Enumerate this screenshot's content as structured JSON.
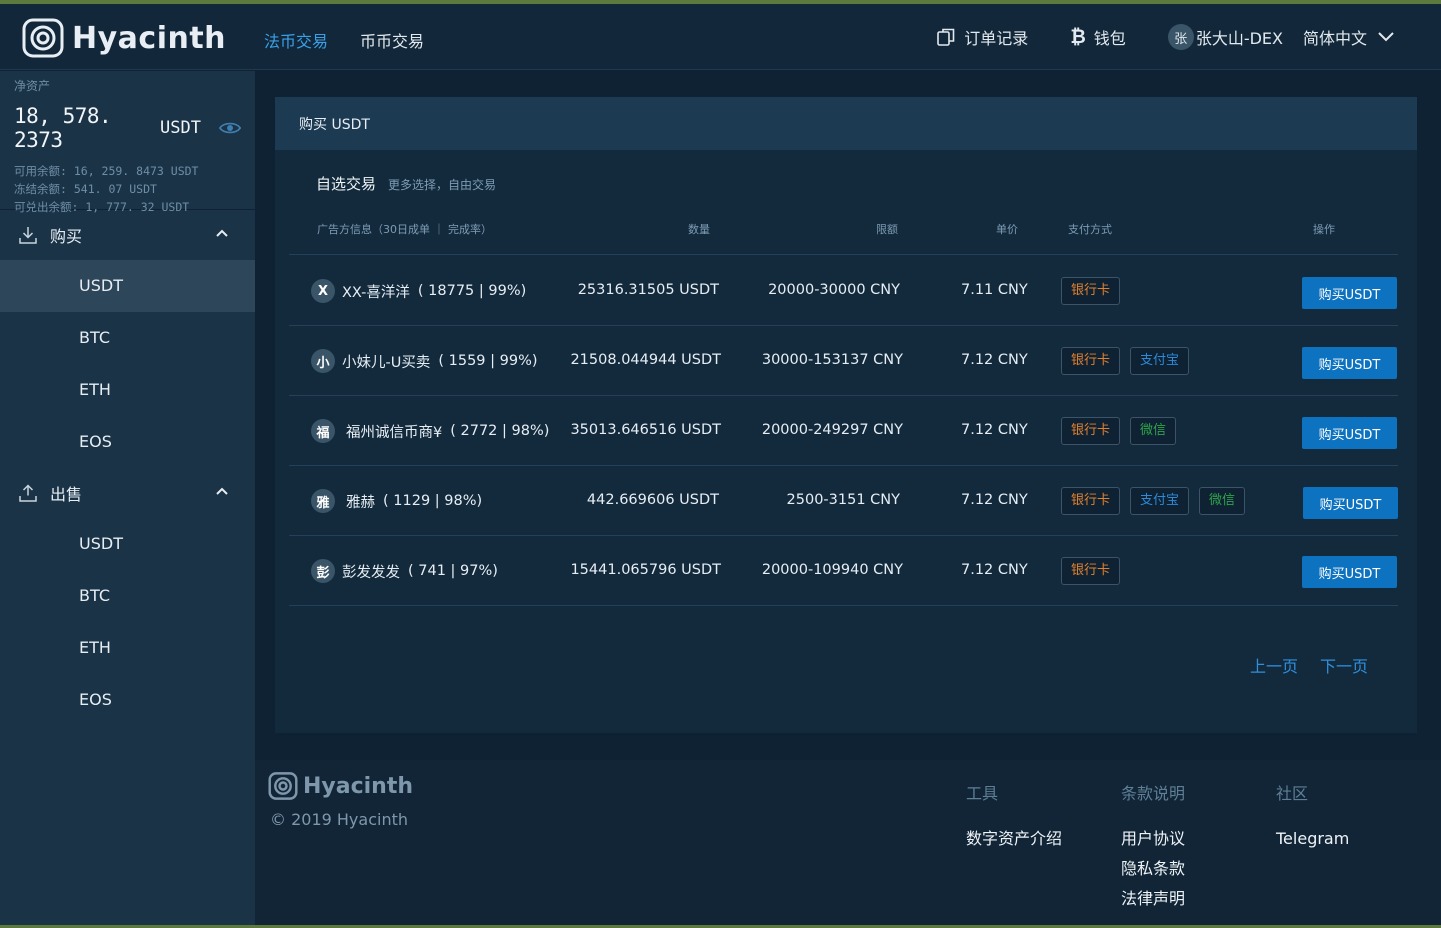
{
  "app": {
    "brand": "Hyacinth"
  },
  "nav": {
    "tabs": [
      {
        "label": "法币交易"
      },
      {
        "label": "币币交易"
      }
    ]
  },
  "header": {
    "orders_label": "订单记录",
    "wallet_label": "钱包",
    "user_avatar": "张",
    "username": "张大山-DEX",
    "language": "简体中文"
  },
  "assets": {
    "label": "净资产",
    "total": "18, 578. 2373",
    "unit": "USDT",
    "available": "可用余额: 16, 259. 8473 USDT",
    "frozen": "冻结余额: 541. 07 USDT",
    "withdrawable": "可兑出余额: 1, 777. 32 USDT"
  },
  "sidebar": {
    "buy_group": "购买",
    "sell_group": "出售",
    "buy_items": [
      "USDT",
      "BTC",
      "ETH",
      "EOS"
    ],
    "sell_items": [
      "USDT",
      "BTC",
      "ETH",
      "EOS"
    ]
  },
  "main": {
    "card_title": "购买 USDT",
    "section_title": "自选交易",
    "section_sub": "更多选择，自由交易",
    "columns": {
      "advertiser": "广告方信息（30日成单 ｜ 完成率）",
      "quantity": "数量",
      "limit": "限额",
      "price": "单价",
      "payment": "支付方式",
      "action": "操作"
    },
    "rows": [
      {
        "avatar": "X",
        "name": "XX-喜洋洋",
        "stats": "( 18775 | 99%)",
        "quantity": "25316.31505 USDT",
        "limit": "20000-30000 CNY",
        "price": "7.11 CNY",
        "payments": [
          "银行卡"
        ],
        "action": "购买USDT"
      },
      {
        "avatar": "小",
        "name": "小妹儿-U买卖",
        "stats": "( 1559 | 99%)",
        "quantity": "21508.044944 USDT",
        "limit": "30000-153137 CNY",
        "price": "7.12 CNY",
        "payments": [
          "银行卡",
          "支付宝"
        ],
        "action": "购买USDT"
      },
      {
        "avatar": "福",
        "name": "福州诚信币商¥",
        "stats": "( 2772 | 98%)",
        "quantity": "35013.646516 USDT",
        "limit": "20000-249297 CNY",
        "price": "7.12 CNY",
        "payments": [
          "银行卡",
          "微信"
        ],
        "action": "购买USDT"
      },
      {
        "avatar": "雅",
        "name": "雅赫",
        "stats": "( 1129 | 98%)",
        "quantity": "442.669606 USDT",
        "limit": "2500-3151 CNY",
        "price": "7.12 CNY",
        "payments": [
          "银行卡",
          "支付宝",
          "微信"
        ],
        "action": "购买USDT"
      },
      {
        "avatar": "彭",
        "name": "彭发发发",
        "stats": "( 741 | 97%)",
        "quantity": "15441.065796 USDT",
        "limit": "20000-109940 CNY",
        "price": "7.12 CNY",
        "payments": [
          "银行卡"
        ],
        "action": "购买USDT"
      }
    ],
    "pager": {
      "prev": "上一页",
      "next": "下一页"
    }
  },
  "footer": {
    "brand": "Hyacinth",
    "copyright": "© 2019 Hyacinth",
    "tools_title": "工具",
    "tools_links": [
      "数字资产介绍"
    ],
    "terms_title": "条款说明",
    "terms_links": [
      "用户协议",
      "隐私条款",
      "法律声明"
    ],
    "community_title": "社区",
    "community_links": [
      "Telegram"
    ]
  },
  "colors": {
    "accent": "#3aa0e8",
    "button": "#0d72c0",
    "bank_tag": "#e0812f",
    "alipay_tag": "#2d8ad8",
    "wechat_tag": "#2fa34a"
  },
  "icons": [
    "logo-icon",
    "orders-icon",
    "bitcoin-icon",
    "eye-icon",
    "download-icon",
    "upload-icon",
    "chevron-up-icon",
    "chevron-down-icon"
  ]
}
